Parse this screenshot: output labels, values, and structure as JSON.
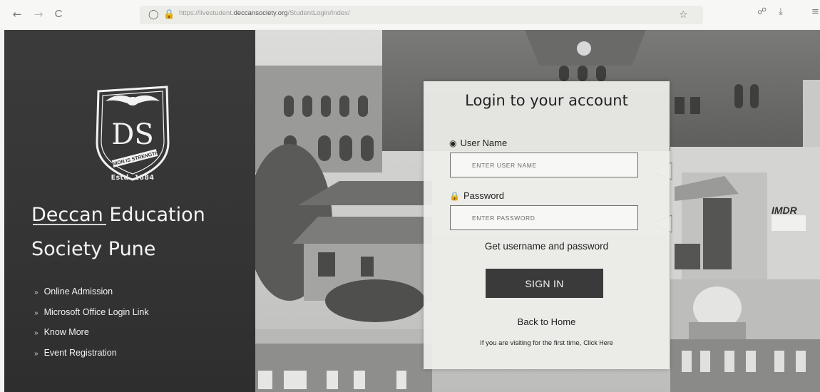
{
  "browser": {
    "back_icon": "←",
    "forward_icon": "→",
    "reload_icon": "C",
    "url_prefix": "https://livestudent.",
    "url_domain": "deccansociety.org",
    "url_path": "/StudentLogin/Index/",
    "right_icons": [
      "star-icon",
      "pocket-icon",
      "download-icon",
      "menu-icon"
    ]
  },
  "sidebar": {
    "estd": "Estd. 1884",
    "logo_motto": "UNION IS STRENGTH",
    "org_line1": "Deccan Education",
    "org_line2": "Society Pune",
    "menu": [
      {
        "label": "Online Admission"
      },
      {
        "label": "Microsoft Office Login Link"
      },
      {
        "label": "Know More"
      },
      {
        "label": "Event Registration"
      }
    ]
  },
  "login": {
    "title": "Login to your account",
    "username_label": "User Name",
    "username_placeholder": "ENTER USER NAME",
    "username_value": "",
    "password_label": "Password",
    "password_placeholder": "ENTER PASSWORD",
    "password_value": "",
    "get_credentials": "Get username and password",
    "signin": "SIGN IN",
    "back_home": "Back to Home",
    "first_time_text": "If you are visiting for the first time,",
    "click_here": "Click Here"
  },
  "background": {
    "building_sign": "IMDR"
  },
  "colors": {
    "sidebar_bg": "#353535",
    "button_bg": "#3a3a3a",
    "card_bg": "#eeeeeb"
  }
}
